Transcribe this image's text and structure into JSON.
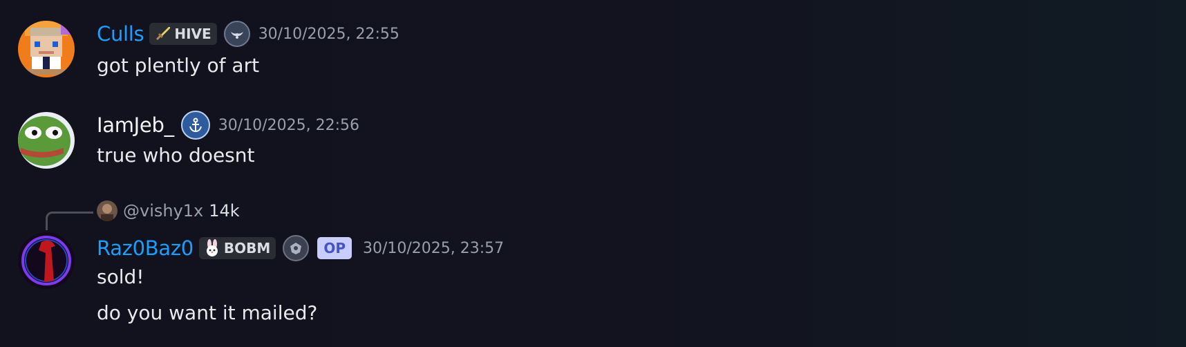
{
  "messages": [
    {
      "author": "Culls",
      "guild_tag": "HIVE",
      "timestamp": "30/10/2025, 22:55",
      "lines": [
        "got plently of art"
      ],
      "badge_icon": "winged-emblem-icon"
    },
    {
      "author": "IamJeb_",
      "timestamp": "30/10/2025, 22:56",
      "lines": [
        "true who doesnt"
      ],
      "badge_icon": "anchor-icon"
    },
    {
      "reply": {
        "user": "@vishy1x",
        "text": "14k"
      },
      "author": "Raz0Baz0",
      "guild_tag": "BOBM",
      "op_label": "OP",
      "timestamp": "30/10/2025, 23:57",
      "lines": [
        "sold!",
        "do you want it mailed?"
      ],
      "badge_icon": "crest-icon"
    }
  ],
  "colors": {
    "name_blue": "#1c9eff",
    "timestamp": "#9aa0aa",
    "op_bg": "#c9cdfb",
    "op_text": "#4752c4",
    "background": "#12121e"
  }
}
